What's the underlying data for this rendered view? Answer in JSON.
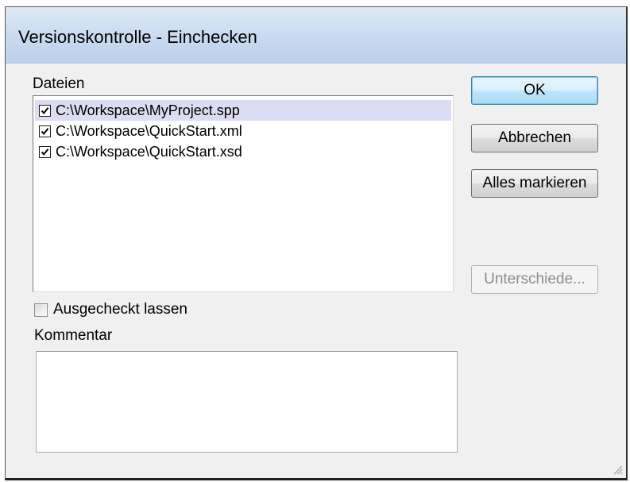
{
  "dialog": {
    "title": "Versionskontrolle - Einchecken"
  },
  "files": {
    "label": "Dateien",
    "items": [
      {
        "path": "C:\\Workspace\\MyProject.spp",
        "checked": true,
        "selected": true
      },
      {
        "path": "C:\\Workspace\\QuickStart.xml",
        "checked": true,
        "selected": false
      },
      {
        "path": "C:\\Workspace\\QuickStart.xsd",
        "checked": true,
        "selected": false
      }
    ]
  },
  "buttons": {
    "ok": "OK",
    "cancel": "Abbrechen",
    "select_all": "Alles markieren",
    "diff": "Unterschiede..."
  },
  "keep_checked_out": {
    "label": "Ausgecheckt lassen",
    "checked": false
  },
  "comment": {
    "label": "Kommentar",
    "value": ""
  },
  "colors": {
    "title_bar": "#c9daf0",
    "dialog_bg": "#f0f0f0",
    "selection": "#dcdcf4",
    "default_button_border": "#3c7fb1",
    "disabled_text": "#8d8d8d"
  }
}
